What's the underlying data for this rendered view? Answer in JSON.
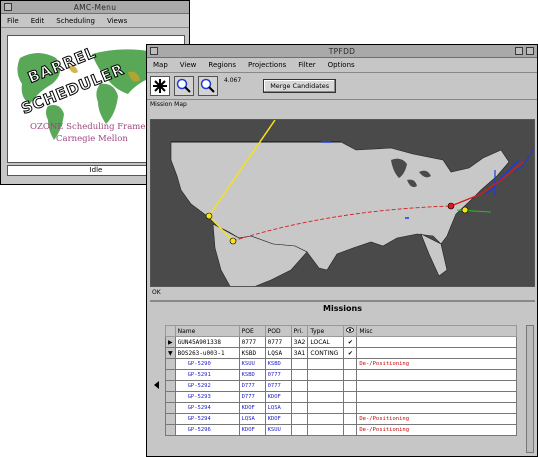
{
  "amc": {
    "title": "AMC-Menu",
    "menu": [
      "File",
      "Edit",
      "Scheduling",
      "Views"
    ],
    "logo_line1": "BARREL",
    "logo_line2": "SCHEDULER",
    "ozone_text": "OZONE Scheduling Frame",
    "cmu_text": "Carnegie Mellon",
    "status": "Idle"
  },
  "main": {
    "title": "TPFDD",
    "menu": [
      "Map",
      "View",
      "Regions",
      "Projections",
      "Filter",
      "Options"
    ],
    "tools": {
      "select_icon": "asterisk-icon",
      "zoom_in_icon": "magnifier-icon",
      "zoom_out_icon": "magnifier-icon"
    },
    "zoom_value": "4.067",
    "merge_button": "Merge Candidates",
    "map_label": "Mission Map",
    "map_status": "OK",
    "missions_title": "Missions",
    "columns": [
      "Name",
      "POE",
      "POD",
      "Pri.",
      "Type",
      "",
      "Misc"
    ],
    "rows": [
      {
        "expand": "▶",
        "name": "GUN45A901338",
        "poe": "0777",
        "pod": "0777",
        "pri": "3A2",
        "type": "LOCAL",
        "flag": "✔",
        "misc": "",
        "style": "normal"
      },
      {
        "expand": "▼",
        "name": "BOS263-u003-1",
        "poe": "KSBD",
        "pod": "LQSA",
        "pri": "3A1",
        "type": "CONTING",
        "flag": "✔",
        "misc": "",
        "style": "normal"
      },
      {
        "expand": "",
        "name": "GP-5290",
        "poe": "KSUU",
        "pod": "KSBD",
        "pri": "",
        "type": "",
        "flag": "",
        "misc": "De-/Positioning",
        "style": "sub"
      },
      {
        "expand": "",
        "name": "GP-5291",
        "poe": "KSBD",
        "pod": "0777",
        "pri": "",
        "type": "",
        "flag": "",
        "misc": "",
        "style": "sub"
      },
      {
        "expand": "",
        "name": "GP-5292",
        "poe": "D777",
        "pod": "0777",
        "pri": "",
        "type": "",
        "flag": "",
        "misc": "",
        "style": "sub"
      },
      {
        "expand": "",
        "name": "GP-5293",
        "poe": "D777",
        "pod": "KDOF",
        "pri": "",
        "type": "",
        "flag": "",
        "misc": "",
        "style": "sub"
      },
      {
        "expand": "",
        "name": "GP-5294",
        "poe": "KDOF",
        "pod": "LQSA",
        "pri": "",
        "type": "",
        "flag": "",
        "misc": "",
        "style": "sub"
      },
      {
        "expand": "",
        "name": "GP-5294",
        "poe": "LQSA",
        "pod": "KDOF",
        "pri": "",
        "type": "",
        "flag": "",
        "misc": "De-/Positioning",
        "style": "sub"
      },
      {
        "expand": "",
        "name": "GP-5296",
        "poe": "KDOF",
        "pod": "KSUU",
        "pri": "",
        "type": "",
        "flag": "",
        "misc": "De-/Positioning",
        "style": "sub"
      }
    ]
  },
  "colors": {
    "window_bg": "#c6c6c6",
    "map_bg": "#4a4a4a",
    "land": "#c8c8c8",
    "route_yellow": "#f4e21c",
    "route_red": "#d81c1c",
    "route_blue": "#1c3cd8",
    "route_green": "#22c022",
    "sub_row_text": "#1c1cc8",
    "misc_text": "#c40000"
  }
}
